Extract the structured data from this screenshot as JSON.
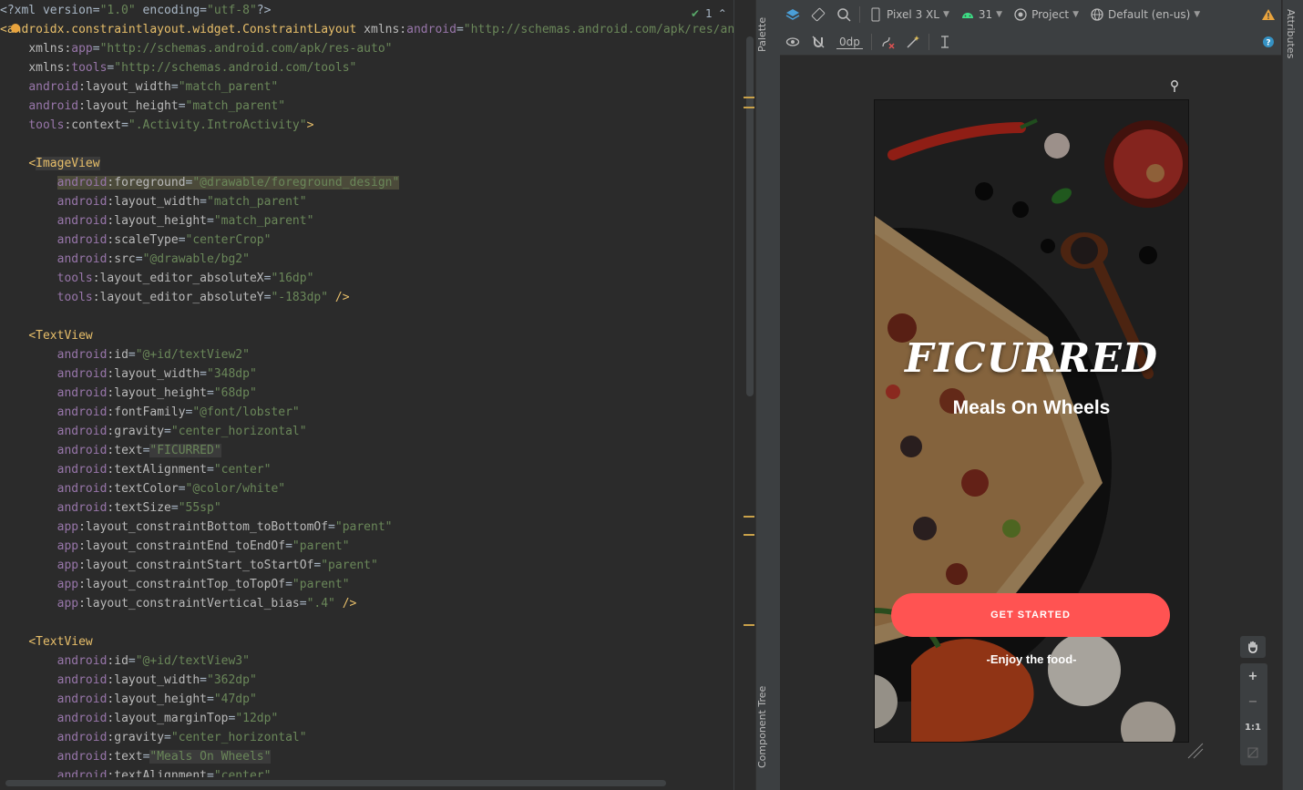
{
  "editor": {
    "inspection_count": "1",
    "lines": [
      [
        [
          "pi",
          "<?xml version="
        ],
        [
          "val",
          "\"1.0\""
        ],
        [
          "pi",
          " encoding="
        ],
        [
          "val",
          "\"utf-8\""
        ],
        [
          "pi",
          "?>"
        ]
      ],
      [
        [
          "tag",
          "<androidx.constraintlayout.widget.ConstraintLayout "
        ],
        [
          "attr",
          "xmlns:"
        ],
        [
          "ns",
          "android"
        ],
        [
          "eq",
          "="
        ],
        [
          "val",
          "\"http://schemas.android.com/apk/res/an"
        ]
      ],
      [
        [
          "indent",
          "    "
        ],
        [
          "attr",
          "xmlns:"
        ],
        [
          "ns",
          "app"
        ],
        [
          "eq",
          "="
        ],
        [
          "val",
          "\"http://schemas.android.com/apk/res-auto\""
        ]
      ],
      [
        [
          "indent",
          "    "
        ],
        [
          "attr",
          "xmlns:"
        ],
        [
          "ns",
          "tools"
        ],
        [
          "eq",
          "="
        ],
        [
          "val",
          "\"http://schemas.android.com/tools\""
        ]
      ],
      [
        [
          "indent",
          "    "
        ],
        [
          "ns",
          "android"
        ],
        [
          "attr",
          ":layout_width"
        ],
        [
          "eq",
          "="
        ],
        [
          "val",
          "\"match_parent\""
        ]
      ],
      [
        [
          "indent",
          "    "
        ],
        [
          "ns",
          "android"
        ],
        [
          "attr",
          ":layout_height"
        ],
        [
          "eq",
          "="
        ],
        [
          "val",
          "\"match_parent\""
        ]
      ],
      [
        [
          "indent",
          "    "
        ],
        [
          "ns",
          "tools"
        ],
        [
          "attr",
          ":context"
        ],
        [
          "eq",
          "="
        ],
        [
          "val",
          "\".Activity.IntroActivity\""
        ],
        [
          "tag",
          ">"
        ]
      ],
      [],
      [
        [
          "indent",
          "    "
        ],
        [
          "tag",
          "<"
        ],
        [
          "taghl",
          "ImageView"
        ]
      ],
      [
        [
          "indent",
          "        "
        ],
        [
          "nshl2",
          "android"
        ],
        [
          "attrhl2",
          ":foreground"
        ],
        [
          "eqhl2",
          "="
        ],
        [
          "valhl2",
          "\"@drawable/foreground_design\""
        ]
      ],
      [
        [
          "indent",
          "        "
        ],
        [
          "ns",
          "android"
        ],
        [
          "attr",
          ":layout_width"
        ],
        [
          "eq",
          "="
        ],
        [
          "val",
          "\"match_parent\""
        ]
      ],
      [
        [
          "indent",
          "        "
        ],
        [
          "ns",
          "android"
        ],
        [
          "attr",
          ":layout_height"
        ],
        [
          "eq",
          "="
        ],
        [
          "val",
          "\"match_parent\""
        ]
      ],
      [
        [
          "indent",
          "        "
        ],
        [
          "ns",
          "android"
        ],
        [
          "attr",
          ":scaleType"
        ],
        [
          "eq",
          "="
        ],
        [
          "val",
          "\"centerCrop\""
        ]
      ],
      [
        [
          "indent",
          "        "
        ],
        [
          "ns",
          "android"
        ],
        [
          "attr",
          ":src"
        ],
        [
          "eq",
          "="
        ],
        [
          "val",
          "\"@drawable/bg2\""
        ]
      ],
      [
        [
          "indent",
          "        "
        ],
        [
          "ns",
          "tools"
        ],
        [
          "attr",
          ":layout_editor_absoluteX"
        ],
        [
          "eq",
          "="
        ],
        [
          "val",
          "\"16dp\""
        ]
      ],
      [
        [
          "indent",
          "        "
        ],
        [
          "ns",
          "tools"
        ],
        [
          "attr",
          ":layout_editor_absoluteY"
        ],
        [
          "eq",
          "="
        ],
        [
          "val",
          "\"-183dp\""
        ],
        [
          "tag",
          " />"
        ]
      ],
      [],
      [
        [
          "indent",
          "    "
        ],
        [
          "tag",
          "<TextView"
        ]
      ],
      [
        [
          "indent",
          "        "
        ],
        [
          "ns",
          "android"
        ],
        [
          "attr",
          ":id"
        ],
        [
          "eq",
          "="
        ],
        [
          "val",
          "\"@+id/textView2\""
        ]
      ],
      [
        [
          "indent",
          "        "
        ],
        [
          "ns",
          "android"
        ],
        [
          "attr",
          ":layout_width"
        ],
        [
          "eq",
          "="
        ],
        [
          "val",
          "\"348dp\""
        ]
      ],
      [
        [
          "indent",
          "        "
        ],
        [
          "ns",
          "android"
        ],
        [
          "attr",
          ":layout_height"
        ],
        [
          "eq",
          "="
        ],
        [
          "val",
          "\"68dp\""
        ]
      ],
      [
        [
          "indent",
          "        "
        ],
        [
          "ns",
          "android"
        ],
        [
          "attr",
          ":fontFamily"
        ],
        [
          "eq",
          "="
        ],
        [
          "val",
          "\"@font/lobster\""
        ]
      ],
      [
        [
          "indent",
          "        "
        ],
        [
          "ns",
          "android"
        ],
        [
          "attr",
          ":gravity"
        ],
        [
          "eq",
          "="
        ],
        [
          "val",
          "\"center_horizontal\""
        ]
      ],
      [
        [
          "indent",
          "        "
        ],
        [
          "ns",
          "android"
        ],
        [
          "attr",
          ":text"
        ],
        [
          "eq",
          "="
        ],
        [
          "valhl",
          "\"FICURRED\""
        ]
      ],
      [
        [
          "indent",
          "        "
        ],
        [
          "ns",
          "android"
        ],
        [
          "attr",
          ":textAlignment"
        ],
        [
          "eq",
          "="
        ],
        [
          "val",
          "\"center\""
        ]
      ],
      [
        [
          "indent",
          "        "
        ],
        [
          "ns",
          "android"
        ],
        [
          "attr",
          ":textColor"
        ],
        [
          "eq",
          "="
        ],
        [
          "val",
          "\"@color/white\""
        ]
      ],
      [
        [
          "indent",
          "        "
        ],
        [
          "ns",
          "android"
        ],
        [
          "attr",
          ":textSize"
        ],
        [
          "eq",
          "="
        ],
        [
          "val",
          "\"55sp\""
        ]
      ],
      [
        [
          "indent",
          "        "
        ],
        [
          "ns",
          "app"
        ],
        [
          "attr",
          ":layout_constraintBottom_toBottomOf"
        ],
        [
          "eq",
          "="
        ],
        [
          "val",
          "\"parent\""
        ]
      ],
      [
        [
          "indent",
          "        "
        ],
        [
          "ns",
          "app"
        ],
        [
          "attr",
          ":layout_constraintEnd_toEndOf"
        ],
        [
          "eq",
          "="
        ],
        [
          "val",
          "\"parent\""
        ]
      ],
      [
        [
          "indent",
          "        "
        ],
        [
          "ns",
          "app"
        ],
        [
          "attr",
          ":layout_constraintStart_toStartOf"
        ],
        [
          "eq",
          "="
        ],
        [
          "val",
          "\"parent\""
        ]
      ],
      [
        [
          "indent",
          "        "
        ],
        [
          "ns",
          "app"
        ],
        [
          "attr",
          ":layout_constraintTop_toTopOf"
        ],
        [
          "eq",
          "="
        ],
        [
          "val",
          "\"parent\""
        ]
      ],
      [
        [
          "indent",
          "        "
        ],
        [
          "ns",
          "app"
        ],
        [
          "attr",
          ":layout_constraintVertical_bias"
        ],
        [
          "eq",
          "="
        ],
        [
          "val",
          "\".4\""
        ],
        [
          "tag",
          " />"
        ]
      ],
      [],
      [
        [
          "indent",
          "    "
        ],
        [
          "tag",
          "<TextView"
        ]
      ],
      [
        [
          "indent",
          "        "
        ],
        [
          "ns",
          "android"
        ],
        [
          "attr",
          ":id"
        ],
        [
          "eq",
          "="
        ],
        [
          "val",
          "\"@+id/textView3\""
        ]
      ],
      [
        [
          "indent",
          "        "
        ],
        [
          "ns",
          "android"
        ],
        [
          "attr",
          ":layout_width"
        ],
        [
          "eq",
          "="
        ],
        [
          "val",
          "\"362dp\""
        ]
      ],
      [
        [
          "indent",
          "        "
        ],
        [
          "ns",
          "android"
        ],
        [
          "attr",
          ":layout_height"
        ],
        [
          "eq",
          "="
        ],
        [
          "val",
          "\"47dp\""
        ]
      ],
      [
        [
          "indent",
          "        "
        ],
        [
          "ns",
          "android"
        ],
        [
          "attr",
          ":layout_marginTop"
        ],
        [
          "eq",
          "="
        ],
        [
          "val",
          "\"12dp\""
        ]
      ],
      [
        [
          "indent",
          "        "
        ],
        [
          "ns",
          "android"
        ],
        [
          "attr",
          ":gravity"
        ],
        [
          "eq",
          "="
        ],
        [
          "val",
          "\"center_horizontal\""
        ]
      ],
      [
        [
          "indent",
          "        "
        ],
        [
          "ns",
          "android"
        ],
        [
          "attr",
          ":text"
        ],
        [
          "eq",
          "="
        ],
        [
          "valhl",
          "\"Meals On Wheels\""
        ]
      ],
      [
        [
          "indent",
          "        "
        ],
        [
          "ns",
          "android"
        ],
        [
          "attr",
          ":textAlignment"
        ],
        [
          "eq",
          "="
        ],
        [
          "val",
          "\"center\""
        ]
      ]
    ]
  },
  "left_strip": {
    "palette_label": "Palette",
    "component_tree_label": "Component Tree"
  },
  "design_toolbar": {
    "device": "Pixel 3 XL",
    "api_level": "31",
    "theme": "Project",
    "locale": "Default (en-us)",
    "margin_value": "0dp",
    "colors": {
      "android_green": "#3ddc84",
      "warning": "#e8a33d",
      "help": "#3592c4"
    }
  },
  "preview": {
    "title": "FICURRED",
    "subtitle": "Meals On Wheels",
    "button_label": "GET STARTED",
    "tagline": "-Enjoy the food-",
    "accent_color": "#ff5352"
  },
  "zoom_controls": {
    "reset_label": "1:1"
  },
  "right_strip": {
    "attributes_label": "Attributes"
  }
}
